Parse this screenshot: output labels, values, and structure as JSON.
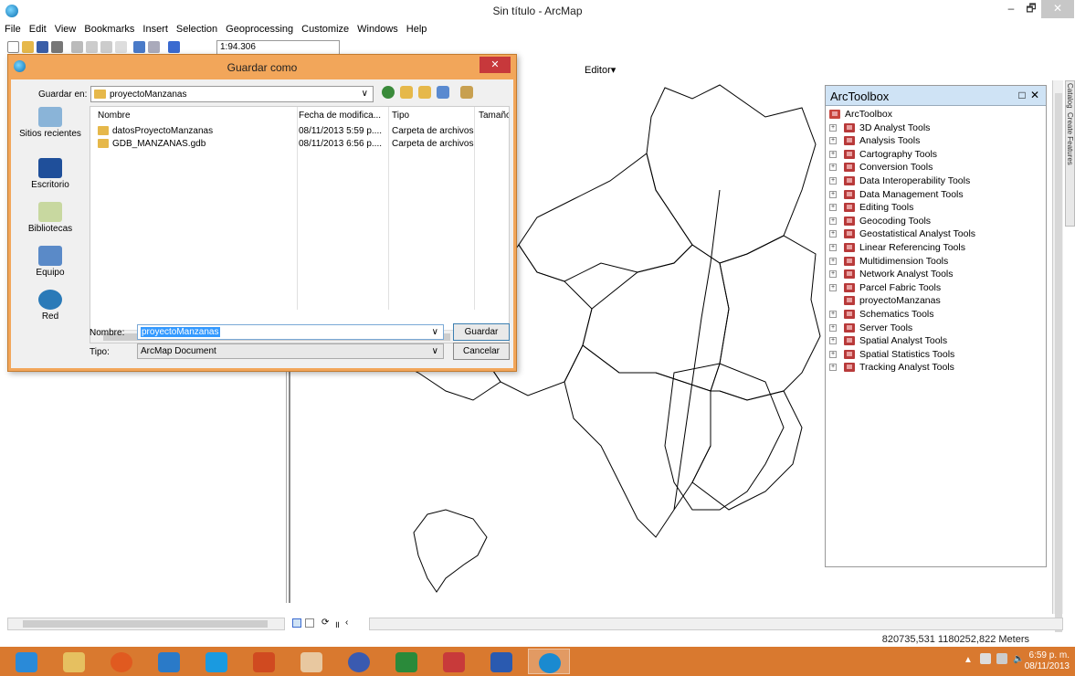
{
  "window": {
    "title": "Sin título - ArcMap",
    "minimize": "–",
    "maximize": "🗗",
    "close": "✕"
  },
  "menu": [
    "File",
    "Edit",
    "View",
    "Bookmarks",
    "Insert",
    "Selection",
    "Geoprocessing",
    "Customize",
    "Windows",
    "Help"
  ],
  "toolbar": {
    "scale": "1:94.306",
    "editor_label": "Editor▾"
  },
  "status": {
    "coordinates": "820735,531  1180252,822 Meters"
  },
  "toolbox": {
    "title": "ArcToolbox",
    "root": "ArcToolbox",
    "items": [
      {
        "label": "3D Analyst Tools",
        "expandable": true
      },
      {
        "label": "Analysis Tools",
        "expandable": true
      },
      {
        "label": "Cartography Tools",
        "expandable": true
      },
      {
        "label": "Conversion Tools",
        "expandable": true
      },
      {
        "label": "Data Interoperability Tools",
        "expandable": true
      },
      {
        "label": "Data Management Tools",
        "expandable": true
      },
      {
        "label": "Editing Tools",
        "expandable": true
      },
      {
        "label": "Geocoding Tools",
        "expandable": true
      },
      {
        "label": "Geostatistical Analyst Tools",
        "expandable": true
      },
      {
        "label": "Linear Referencing Tools",
        "expandable": true
      },
      {
        "label": "Multidimension Tools",
        "expandable": true
      },
      {
        "label": "Network Analyst Tools",
        "expandable": true
      },
      {
        "label": "Parcel Fabric Tools",
        "expandable": true
      },
      {
        "label": "proyectoManzanas",
        "expandable": false
      },
      {
        "label": "Schematics Tools",
        "expandable": true
      },
      {
        "label": "Server Tools",
        "expandable": true
      },
      {
        "label": "Spatial Analyst Tools",
        "expandable": true
      },
      {
        "label": "Spatial Statistics Tools",
        "expandable": true
      },
      {
        "label": "Tracking Analyst Tools",
        "expandable": true
      }
    ]
  },
  "dialog": {
    "title": "Guardar como",
    "save_in_label": "Guardar en:",
    "save_in_value": "proyectoManzanas",
    "places": [
      "Sitios recientes",
      "Escritorio",
      "Bibliotecas",
      "Equipo",
      "Red"
    ],
    "columns": [
      "Nombre",
      "Fecha de modifica...",
      "Tipo",
      "Tamaño"
    ],
    "files": [
      {
        "name": "datosProyectoManzanas",
        "date": "08/11/2013 5:59 p....",
        "type": "Carpeta de archivos"
      },
      {
        "name": "GDB_MANZANAS.gdb",
        "date": "08/11/2013 6:56 p....",
        "type": "Carpeta de archivos"
      }
    ],
    "name_label": "Nombre:",
    "name_value": "proyectoManzanas",
    "type_label": "Tipo:",
    "type_value": "ArcMap Document",
    "save_button": "Guardar",
    "cancel_button": "Cancelar"
  },
  "side_tabs": [
    "Catalog",
    "Create Features"
  ],
  "taskbar": {
    "time": "6:59 p. m.",
    "date": "08/11/2013"
  },
  "colors": {
    "dialog_frame": "#f2a65a",
    "taskbar": "#d9792f",
    "selection": "#3399ff",
    "toolbox_header": "#cfe3f5"
  }
}
